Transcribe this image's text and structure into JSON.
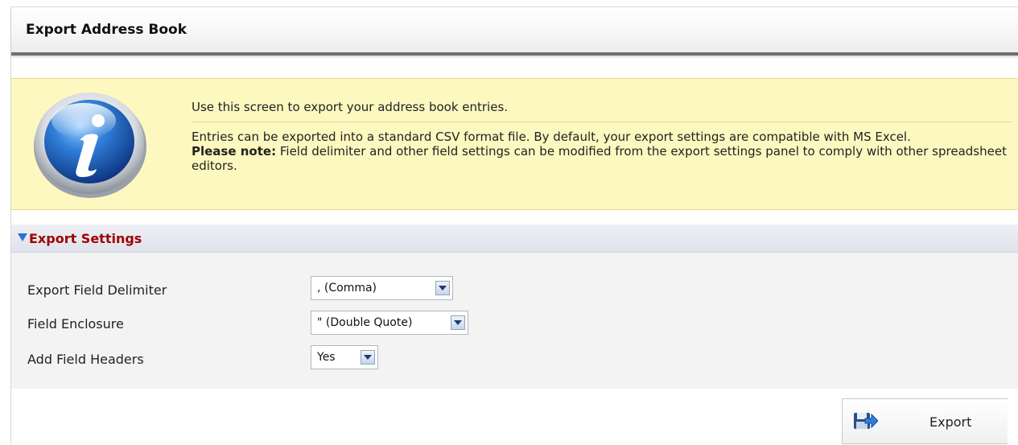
{
  "page": {
    "title": "Export Address Book"
  },
  "info": {
    "icon": "info-icon",
    "line1": "Use this screen to export your address book entries.",
    "para1": "Entries can be exported into a standard CSV format file. By default, your export settings are compatible with MS Excel.",
    "note_label": "Please note:",
    "note_text": " Field delimiter and other field settings can be modified from the export settings panel to comply with other spreadsheet editors."
  },
  "settings": {
    "header": "Export Settings",
    "rows": [
      {
        "label": "Export Field Delimiter",
        "value": ", (Comma)"
      },
      {
        "label": "Field Enclosure",
        "value": "\" (Double Quote)"
      },
      {
        "label": "Add Field Headers",
        "value": "Yes"
      }
    ]
  },
  "actions": {
    "export_label": "Export",
    "export_icon": "save-export-icon"
  },
  "colors": {
    "info_background": "#fdf8c0",
    "section_header_text": "#a00000",
    "accent_blue": "#2f6fd4"
  }
}
